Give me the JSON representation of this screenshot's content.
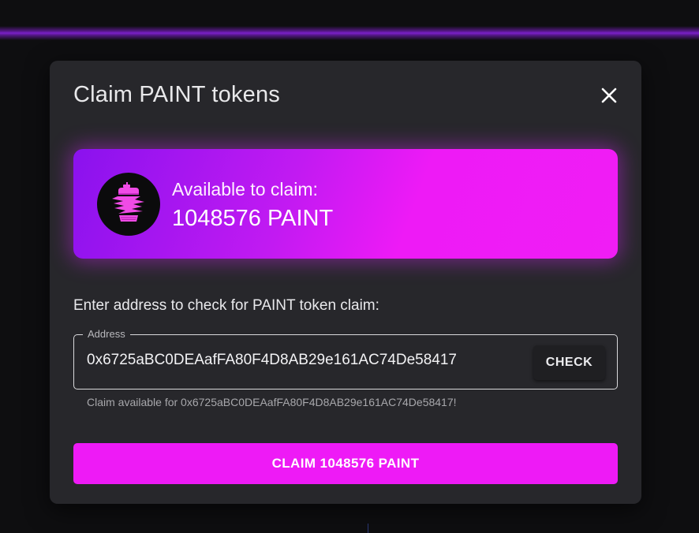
{
  "dialog": {
    "title": "Claim PAINT tokens"
  },
  "banner": {
    "label": "Available to claim:",
    "amount": "1048576 PAINT",
    "logo_icon": "spray-can-icon"
  },
  "form": {
    "prompt": "Enter address to check for PAINT token claim:",
    "field_label": "Address",
    "address_value": "0x6725aBC0DEAafFA80F4D8AB29e161AC74De58417",
    "check_label": "CHECK",
    "helper_text": "Claim available for 0x6725aBC0DEAafFA80F4D8AB29e161AC74De58417!"
  },
  "actions": {
    "claim_label": "CLAIM 1048576 PAINT"
  },
  "colors": {
    "accent": "#ee1af6",
    "accent_purple": "#8a12ee",
    "modal_bg": "#27272b",
    "page_bg": "#0e0e10"
  }
}
